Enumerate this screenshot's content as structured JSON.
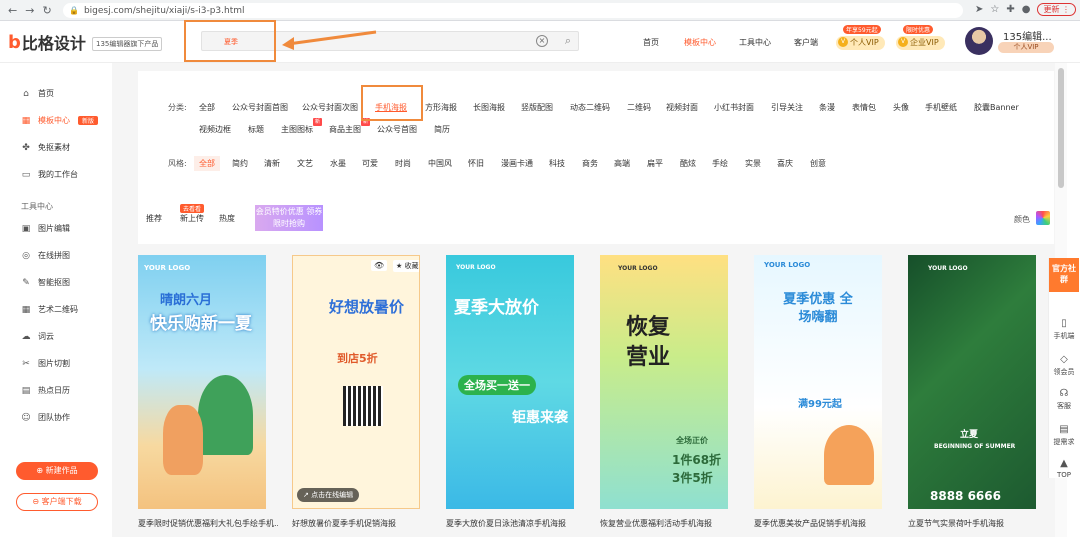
{
  "browser": {
    "url": "bigesj.com/shejitu/xiaji/s-i3-p3.html",
    "update_label": "更新 ⋮"
  },
  "header": {
    "logo_text": "比格设计",
    "tagline": "135编辑器旗下产品",
    "search_value": "夏季",
    "nav": [
      "首页",
      "模板中心",
      "工具中心",
      "客户端"
    ],
    "vip_personal": {
      "tag": "年享59元起",
      "label": "个人VIP"
    },
    "vip_company": {
      "tag": "限时优惠",
      "label": "企业VIP"
    },
    "user_name": "135编辑...",
    "user_vip": "个人VIP"
  },
  "sidebar": {
    "items": [
      {
        "label": "首页",
        "icon": "home-icon"
      },
      {
        "label": "模板中心",
        "icon": "template-icon",
        "badge": "新版"
      },
      {
        "label": "免抠素材",
        "icon": "material-icon"
      },
      {
        "label": "我的工作台",
        "icon": "workspace-icon"
      }
    ],
    "section_title": "工具中心",
    "tools": [
      "图片编辑",
      "在线拼图",
      "智能抠图",
      "艺术二维码",
      "词云",
      "图片切割",
      "热点日历",
      "团队协作"
    ],
    "new_work": "新建作品",
    "client_download": "客户端下载"
  },
  "filters": {
    "category_label": "分类:",
    "categories": [
      "全部",
      "公众号封面首图",
      "公众号封面次图",
      "手机海报",
      "方形海报",
      "长图海报",
      "竖版配图",
      "动态二维码",
      "二维码",
      "视频封面",
      "小红书封面",
      "引导关注",
      "条漫",
      "表情包",
      "头像",
      "手机壁纸",
      "胶囊Banner",
      "视频边框",
      "标题",
      "主图图标",
      "商品主图",
      "公众号首图",
      "简历"
    ],
    "style_label": "风格:",
    "styles": [
      "全部",
      "简约",
      "清新",
      "文艺",
      "水墨",
      "可爱",
      "时尚",
      "中国风",
      "怀旧",
      "漫画卡通",
      "科技",
      "商务",
      "高端",
      "扁平",
      "酷炫",
      "手绘",
      "实景",
      "喜庆",
      "创意"
    ],
    "sort": [
      "推荐",
      "新上传",
      "热度"
    ],
    "sort_badge": "去看看",
    "promo": "会员特价优惠 领券限时抢购",
    "color_label": "颜色"
  },
  "cards": [
    {
      "caption": "夏季限时促销优惠福利大礼包手绘手机...",
      "title": "快乐购新一夏",
      "sub": "晴朗六月",
      "logo": "YOUR LOGO"
    },
    {
      "caption": "好想放暑价夏季手机促销海报",
      "title": "好想放暑价",
      "sub": "到店5折",
      "fav": "收藏",
      "edit": "点击在线编辑"
    },
    {
      "caption": "夏季大放价夏日泳池清凉手机海报",
      "title": "夏季大放价",
      "sub": "全场买一送一",
      "deal": "钜惠来袭",
      "logo": "YOUR LOGO"
    },
    {
      "caption": "恢复营业优惠福利活动手机海报",
      "title": "恢复营业",
      "sub": "全场正价",
      "deal": "1件68折 3件5折",
      "logo": "YOUR LOGO"
    },
    {
      "caption": "夏季优惠美妆产品促销手机海报",
      "title": "夏季优惠 全场嗨翻",
      "sub": "满99元起",
      "logo": "YOUR LOGO"
    },
    {
      "caption": "立夏节气实景荷叶手机海报",
      "title": "立夏",
      "sub": "BEGINNING OF SUMMER",
      "deal": "8888 6666",
      "logo": "YOUR LOGO"
    }
  ],
  "right_bar": {
    "top": "官方社群",
    "items": [
      "手机端",
      "领会员",
      "客服",
      "提需求",
      "TOP"
    ]
  }
}
